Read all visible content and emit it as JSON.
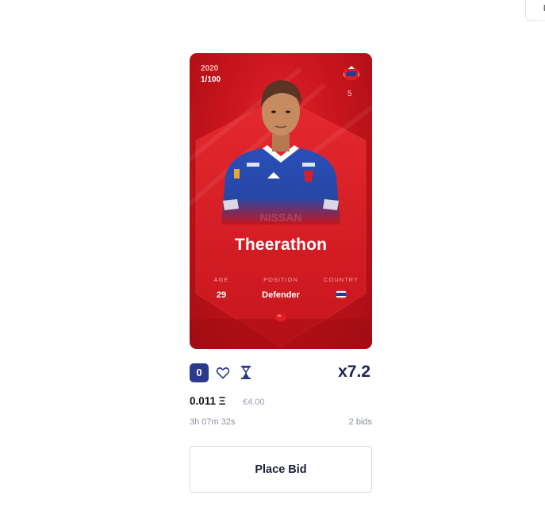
{
  "top_right_button": {
    "label": "l"
  },
  "card": {
    "season": "2020",
    "serial": "1/100",
    "shirt_number": "5",
    "player_name": "Theerathon",
    "stats": {
      "age": {
        "label": "AGE",
        "value": "29"
      },
      "position": {
        "label": "POSITION",
        "value": "Defender"
      },
      "country": {
        "label": "COUNTRY",
        "flag_icon": "thailand-flag-icon"
      }
    },
    "colors": {
      "card_red": "#c9151d",
      "jersey_blue": "#2a4fb8"
    }
  },
  "actions": {
    "badge_count": "0",
    "multiplier": "x7.2"
  },
  "price": {
    "eth": "0.011 Ξ",
    "eur": "€4.00"
  },
  "auction": {
    "time_left": "3h 07m 32s",
    "bids": "2 bids"
  },
  "bid_button": {
    "label": "Place Bid"
  },
  "accent": "#2b3a8c"
}
